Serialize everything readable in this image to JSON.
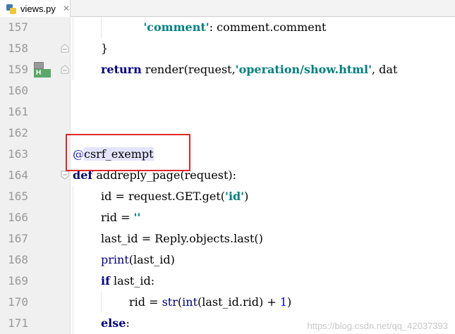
{
  "tab": {
    "label": "views.py",
    "close": "✕"
  },
  "lines": [
    {
      "n": "157",
      "tokens": [
        [
          "",
          "    "
        ],
        [
          "str",
          "'comment'"
        ],
        [
          "",
          ": comment.comment"
        ]
      ]
    },
    {
      "n": "158",
      "tokens": [
        [
          "",
          "}"
        ]
      ]
    },
    {
      "n": "159",
      "tokens": [
        [
          "kw",
          "return"
        ],
        [
          "",
          " render(request,"
        ],
        [
          "str",
          "'operation/show.html'"
        ],
        [
          "",
          ", dat"
        ]
      ]
    },
    {
      "n": "160",
      "tokens": []
    },
    {
      "n": "161",
      "tokens": []
    },
    {
      "n": "162",
      "tokens": []
    },
    {
      "n": "163",
      "tokens": [
        [
          "dec",
          "@"
        ],
        [
          "dec-name",
          "csrf_exempt"
        ]
      ]
    },
    {
      "n": "164",
      "tokens": [
        [
          "kw",
          "def"
        ],
        [
          "",
          " addreply_page(request):"
        ]
      ]
    },
    {
      "n": "165",
      "tokens": [
        [
          "",
          "id = request.GET.get("
        ],
        [
          "str",
          "'id'"
        ],
        [
          "",
          ")"
        ]
      ]
    },
    {
      "n": "166",
      "tokens": [
        [
          "",
          "rid = "
        ],
        [
          "str",
          "''"
        ]
      ]
    },
    {
      "n": "167",
      "tokens": [
        [
          "",
          "last_id = Reply.objects.last()"
        ]
      ]
    },
    {
      "n": "168",
      "tokens": [
        [
          "bi",
          "print"
        ],
        [
          "",
          "(last_id)"
        ]
      ]
    },
    {
      "n": "169",
      "tokens": [
        [
          "kw",
          "if"
        ],
        [
          "",
          " last_id:"
        ]
      ]
    },
    {
      "n": "170",
      "tokens": [
        [
          "",
          "rid = "
        ],
        [
          "bi",
          "str"
        ],
        [
          "",
          "("
        ],
        [
          "bi",
          "int"
        ],
        [
          "",
          "(last_id.rid) + "
        ],
        [
          "num",
          "1"
        ],
        [
          "",
          ")"
        ]
      ]
    },
    {
      "n": "171",
      "tokens": [
        [
          "kw",
          "else"
        ],
        [
          "",
          ":"
        ]
      ]
    }
  ],
  "gutter_marker": {
    "label": "H"
  },
  "watermark": "https://blog.csdn.net/qq_42037393"
}
